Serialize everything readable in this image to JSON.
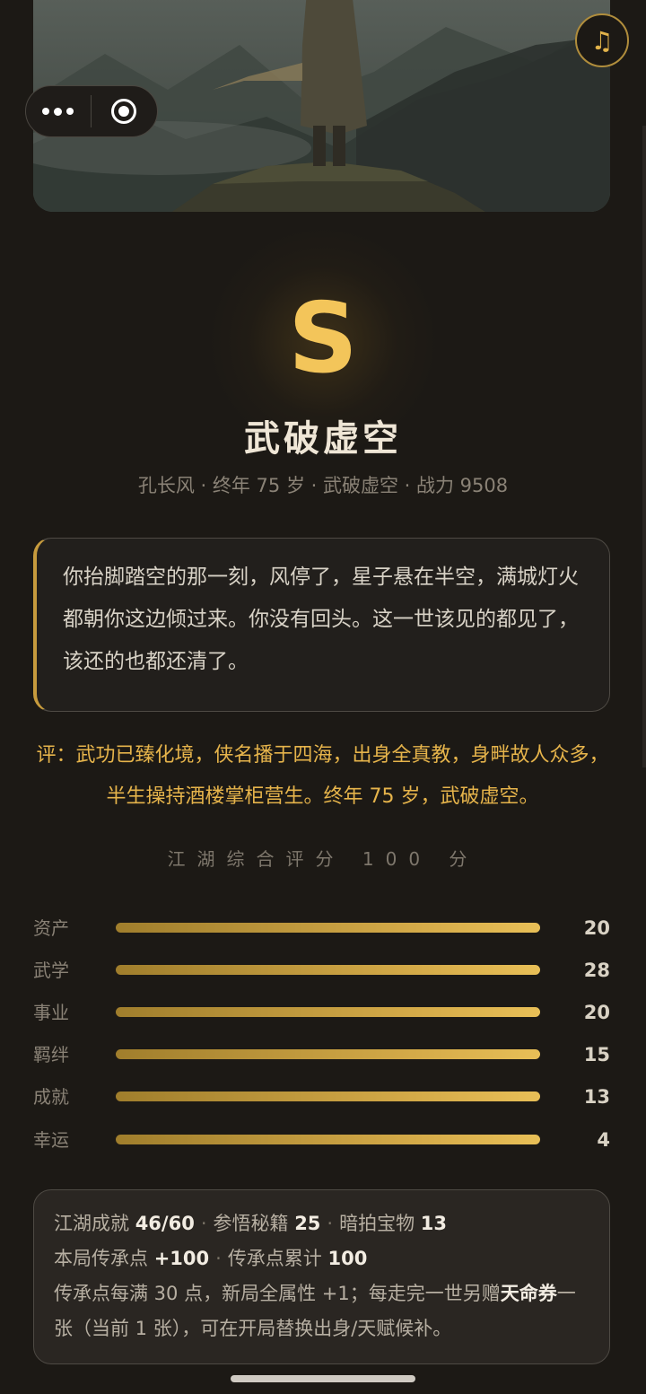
{
  "hero": {
    "image_name": "hero-illustration"
  },
  "top_buttons": {
    "music_icon": "music-note-icon",
    "more_icon": "more-dots-icon",
    "close_icon": "target-icon"
  },
  "result": {
    "grade": "S",
    "title": "武破虚空",
    "subtitle": "孔长风 · 终年 75 岁 · 武破虚空 · 战力 9508"
  },
  "quote": {
    "text": "你抬脚踏空的那一刻，风停了，星子悬在半空，满城灯火都朝你这边倾过来。你没有回头。这一世该见的都见了，该还的也都还清了。"
  },
  "comment": "评：武功已臻化境，侠名播于四海，出身全真教，身畔故人众多，半生操持酒楼掌柜营生。终年 75 岁，武破虚空。",
  "score_title": "江湖综合评分 100 分",
  "stats": [
    {
      "label": "资产",
      "value": "20"
    },
    {
      "label": "武学",
      "value": "28"
    },
    {
      "label": "事业",
      "value": "20"
    },
    {
      "label": "羁绊",
      "value": "15"
    },
    {
      "label": "成就",
      "value": "13"
    },
    {
      "label": "幸运",
      "value": "4"
    }
  ],
  "summary": {
    "line1": {
      "achievements_label": "江湖成就",
      "achievements_value": "46/60",
      "secrets_label": "参悟秘籍",
      "secrets_value": "25",
      "treasures_label": "暗拍宝物",
      "treasures_value": "13"
    },
    "line2": {
      "points_label": "本局传承点",
      "points_value": "+100",
      "total_label": "传承点累计",
      "total_value": "100"
    },
    "note_before": "传承点每满 30 点，新局全属性 +1；每走完一世另赠",
    "note_bold": "天命券",
    "note_after": "一张（当前 1 张），可在开局替换出身/天赋候补。"
  },
  "colors": {
    "accent": "#f3c55a",
    "gold_bar": "#d4aa48",
    "background": "#1c1915"
  }
}
